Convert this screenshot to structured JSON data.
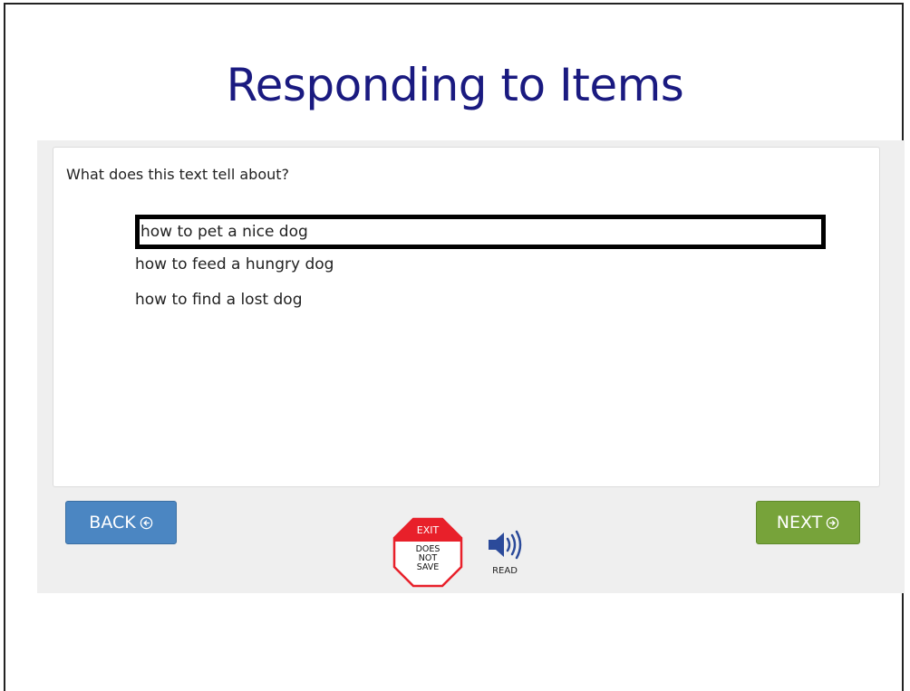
{
  "slide": {
    "title": "Responding to Items"
  },
  "item": {
    "question": "What does this text tell about?",
    "options": [
      {
        "label": "how to pet a nice dog",
        "selected": true
      },
      {
        "label": "how to feed a hungry dog",
        "selected": false
      },
      {
        "label": "how to find a lost dog",
        "selected": false
      }
    ]
  },
  "navigation": {
    "back_label": "BACK",
    "next_label": "NEXT",
    "back_color": "#4b86c2",
    "next_color": "#77a33a"
  },
  "tools": {
    "exit": {
      "label": "EXIT",
      "sub_lines": [
        "DOES",
        "NOT",
        "SAVE"
      ],
      "icon": "stop-sign-icon",
      "color": "#e8202a"
    },
    "read": {
      "label": "READ",
      "icon": "speaker-icon",
      "color": "#2b4a9a"
    }
  },
  "colors": {
    "title": "#1a1a80",
    "panel_background": "#efefef",
    "selection_border": "#000000"
  }
}
